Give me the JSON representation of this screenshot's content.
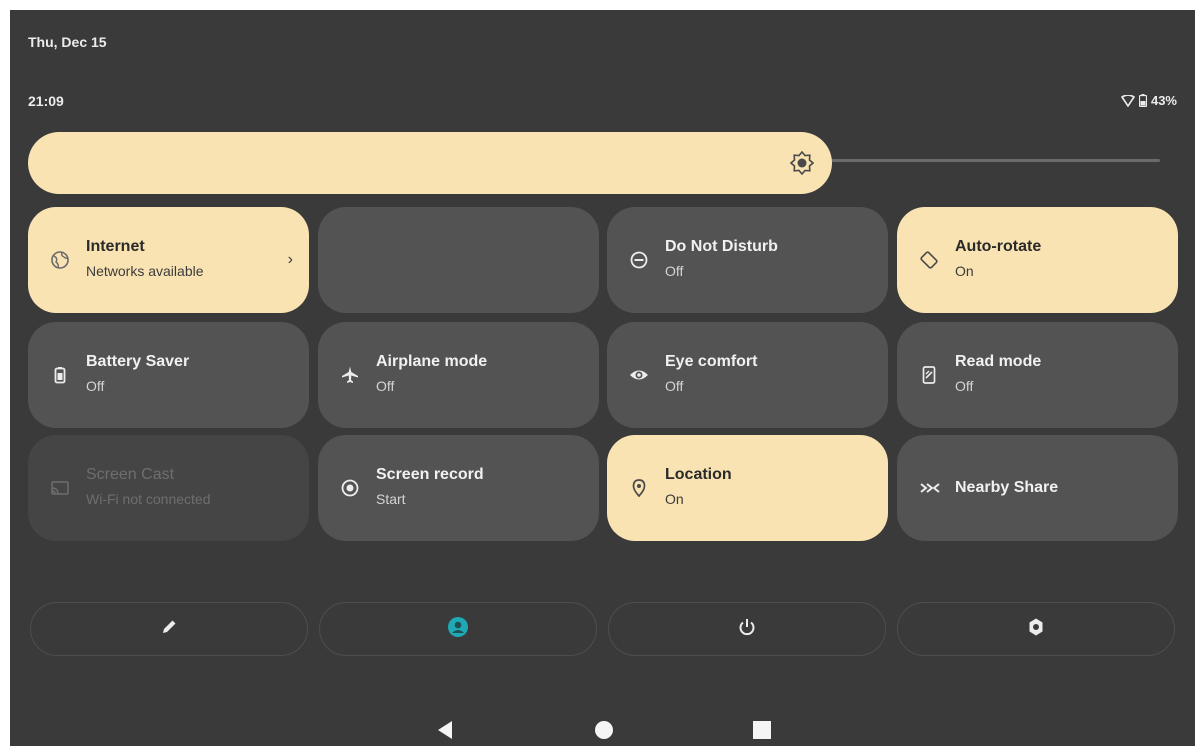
{
  "status_bar": {
    "date": "Thu, Dec 15",
    "time": "21:09",
    "battery": "43%",
    "icons": [
      "wifi-icon",
      "battery-icon"
    ]
  },
  "brightness": {
    "level": 0.7,
    "icon": "brightness-icon"
  },
  "tiles": [
    {
      "title": "Internet",
      "subtitle": "Networks available",
      "state": "on",
      "icon": "globe-icon",
      "chevron": "›"
    },
    {
      "title": "",
      "subtitle": "",
      "state": "off",
      "icon": ""
    },
    {
      "title": "Do Not Disturb",
      "subtitle": "Off",
      "state": "off",
      "icon": "do-not-disturb-icon"
    },
    {
      "title": "Auto-rotate",
      "subtitle": "On",
      "state": "on",
      "icon": "auto-rotate-icon"
    },
    {
      "title": "Battery Saver",
      "subtitle": "Off",
      "state": "off",
      "icon": "battery-saver-icon"
    },
    {
      "title": "Airplane mode",
      "subtitle": "Off",
      "state": "off",
      "icon": "airplane-icon"
    },
    {
      "title": "Eye comfort",
      "subtitle": "Off",
      "state": "off",
      "icon": "eye-icon"
    },
    {
      "title": "Read mode",
      "subtitle": "Off",
      "state": "off",
      "icon": "read-mode-icon"
    },
    {
      "title": "Screen Cast",
      "subtitle": "Wi-Fi not connected",
      "state": "disabled",
      "icon": "screen-cast-icon"
    },
    {
      "title": "Screen record",
      "subtitle": "Start",
      "state": "off",
      "icon": "screen-record-icon"
    },
    {
      "title": "Location",
      "subtitle": "On",
      "state": "on",
      "icon": "location-icon"
    },
    {
      "title": "Nearby Share",
      "subtitle": "",
      "state": "off",
      "icon": "nearby-share-icon"
    }
  ],
  "bottom_buttons": [
    "edit-icon",
    "user-icon",
    "power-icon",
    "settings-icon"
  ],
  "nav": [
    "back-icon",
    "home-icon",
    "recents-icon"
  ],
  "colors": {
    "background": "#3a3a3a",
    "tile_on": "#f9e3b2",
    "tile_off": "#535353",
    "user_accent": "#1fa9b4"
  }
}
